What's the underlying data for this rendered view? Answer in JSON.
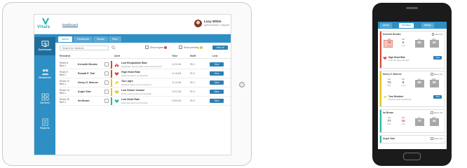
{
  "colors": {
    "brand": "#22b3a6",
    "primary": "#2d8fc4",
    "sidebar_active": "#1f6d9a",
    "button": "#2d7fb6",
    "alert_red": "#d9483b",
    "alert_yellow": "#e2c619",
    "alert_teal": "#27b7a2"
  },
  "app": {
    "logo_text": "Vitals",
    "breadcrumb": "Dashboard"
  },
  "user": {
    "name": "Lucy White",
    "role": "Administrator, Hospital"
  },
  "sidebar": {
    "items": [
      {
        "label": "Dashboard",
        "icon": "monitor-icon"
      },
      {
        "label": "Residents",
        "icon": "people-icon"
      },
      {
        "label": "Devices",
        "icon": "devices-icon"
      },
      {
        "label": "Reports",
        "icon": "document-icon"
      }
    ]
  },
  "tabs": [
    "Alerts",
    "Residents",
    "Status",
    "Plan"
  ],
  "filters": {
    "search_placeholder": "Search for residents",
    "show_urgent": "Show urgent",
    "show_pending": "Show pending",
    "view_all": "View all"
  },
  "table": {
    "headers": {
      "resident": "Resident",
      "alert": "Alert",
      "time": "Time",
      "staff": "Staff",
      "link": "Link"
    },
    "rows": [
      {
        "room": "Room 8",
        "bed": "Bed 1",
        "name": "Kenneth Brooks",
        "alert_title": "Low Respiration Rate",
        "alert_desc": "Respiration rate has fallen below set threshold",
        "time": "11:20 AM",
        "staff": "RN 1",
        "button": "View",
        "severity": "red",
        "icon": "lungs-icon"
      },
      {
        "room": "Room 9",
        "bed": "Bed 2",
        "name": "Ronald P. Teal",
        "alert_title": "High Heart Rate",
        "alert_desc": "Heart rate above set threshold",
        "time": "11:18 AM",
        "staff": "RN 2",
        "button": "View",
        "severity": "red",
        "icon": "heart-icon"
      },
      {
        "room": "Room 12",
        "bed": "Bed 1",
        "name": "Henry G. Monroe",
        "alert_title": "Turn right",
        "alert_desc": "Resident needs to be repositioned",
        "time": "11:10 AM",
        "staff": "RN 1",
        "button": "View",
        "severity": "yellow",
        "icon": "turn-icon"
      },
      {
        "room": "Room 14",
        "bed": "Bed 1",
        "name": "Angel Vida",
        "alert_title": "Low Stroke Volume",
        "alert_desc": "Stroke volume under set threshold",
        "time": "11:02 AM",
        "staff": "RN 3",
        "button": "View",
        "severity": "yellow",
        "icon": "heart-icon"
      },
      {
        "room": "Room 15",
        "bed": "Bed 2",
        "name": "Ira Brown",
        "alert_title": "Low Heart Rate",
        "alert_desc": "Heart rate below set threshold",
        "time": "10:55 AM",
        "staff": "RN 2",
        "button": "View",
        "severity": "teal",
        "icon": "heart-icon"
      }
    ]
  },
  "phone": {
    "tabs": [
      "Alerts",
      "Monitors",
      "Status"
    ],
    "cards": [
      {
        "title": "Kenneth Brooks",
        "room": "Room 8",
        "severity": "red",
        "vitals": [
          {
            "top": "HR",
            "num": "78",
            "sub": "bpm"
          },
          {
            "top": "RR",
            "num": "6",
            "sub": "/min"
          },
          {
            "top": "SV",
            "num": "64",
            "sub": "ml"
          },
          {
            "top": "HRV",
            "num": "42",
            "sub": "ms"
          }
        ],
        "alert_title": "High Heart Rate",
        "alert_desc": "Heart rate above threshold",
        "button": "View"
      },
      {
        "title": "Henry G. Monroe",
        "room": "Room 12",
        "severity": "yellow",
        "vitals": [
          {
            "top": "HR",
            "num": "71",
            "sub": "bpm"
          },
          {
            "top": "RR",
            "num": "8",
            "sub": "/min"
          },
          {
            "top": "SV",
            "num": "68",
            "sub": "ml"
          },
          {
            "top": "HRV",
            "num": "39",
            "sub": "ms"
          }
        ],
        "alert_title": "Turn Resident",
        "alert_desc": "Resident needs repositioning",
        "button": "View"
      },
      {
        "title": "Ira Brown",
        "room": "Room 15",
        "severity": "teal",
        "vitals": [
          {
            "top": "HR",
            "num": "77",
            "sub": "bpm"
          },
          {
            "top": "RR",
            "num": "19",
            "sub": "/min"
          },
          {
            "top": "SV",
            "num": "70",
            "sub": "ml"
          },
          {
            "top": "HRV",
            "num": "45",
            "sub": "ms"
          }
        ],
        "alert_title": "",
        "alert_desc": "",
        "button": ""
      },
      {
        "title": "Angel Vida",
        "room": "Room 14",
        "severity": "teal",
        "vitals": [],
        "alert_title": "",
        "alert_desc": "",
        "button": ""
      }
    ]
  }
}
